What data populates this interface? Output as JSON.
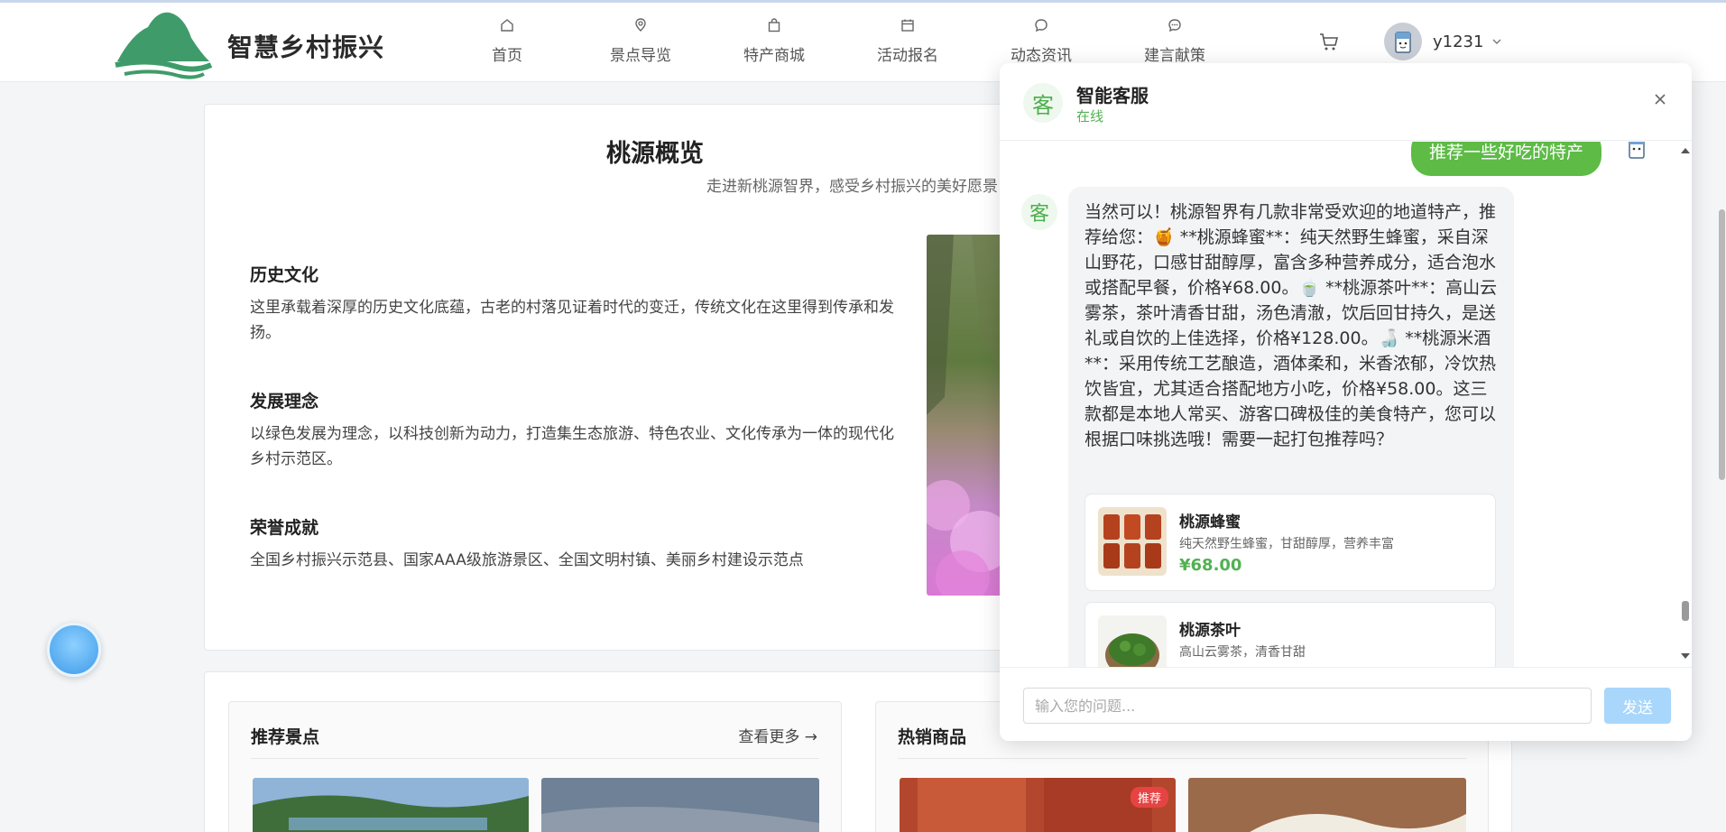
{
  "header": {
    "site_name": "智慧乡村振兴",
    "nav": [
      {
        "label": "首页",
        "icon": "home-icon"
      },
      {
        "label": "景点导览",
        "icon": "map-pin-icon"
      },
      {
        "label": "特产商城",
        "icon": "shopping-bag-icon"
      },
      {
        "label": "活动报名",
        "icon": "calendar-icon"
      },
      {
        "label": "动态资讯",
        "icon": "chat-bubble-icon"
      },
      {
        "label": "建言献策",
        "icon": "comment-dots-icon"
      }
    ],
    "username": "y1231"
  },
  "overview": {
    "title": "桃源概览",
    "subtitle": "走进新桃源智界，感受乡村振兴的美好愿景",
    "sections": [
      {
        "title": "历史文化",
        "text": "这里承载着深厚的历史文化底蕴，古老的村落见证着时代的变迁，传统文化在这里得到传承和发扬。"
      },
      {
        "title": "发展理念",
        "text": "以绿色发展为理念，以科技创新为动力，打造集生态旅游、特色农业、文化传承为一体的现代化乡村示范区。"
      },
      {
        "title": "荣誉成就",
        "text": "全国乡村振兴示范县、国家AAA级旅游景区、全国文明村镇、美丽乡村建设示范点"
      }
    ]
  },
  "recommend": {
    "spots_title": "推荐景点",
    "spots_more": "查看更多 →",
    "goods_title": "热销商品",
    "hot_tag": "推荐"
  },
  "chat": {
    "avatar_char": "客",
    "name": "智能客服",
    "status": "在线",
    "user_message": "推荐一些好吃的特产",
    "bot_reply": "当然可以！桃源智界有几款非常受欢迎的地道特产，推荐给您：🍯 **桃源蜂蜜**：纯天然野生蜂蜜，采自深山野花，口感甘甜醇厚，富含多种营养成分，适合泡水或搭配早餐，价格¥68.00。🍵 **桃源茶叶**：高山云雾茶，茶叶清香甘甜，汤色清澈，饮后回甘持久，是送礼或自饮的上佳选择，价格¥128.00。🍶 **桃源米酒**：采用传统工艺酿造，酒体柔和，米香浓郁，冷饮热饮皆宜，尤其适合搭配地方小吃，价格¥58.00。这三款都是本地人常买、游客口碑极佳的美食特产，您可以根据口味挑选哦！需要一起打包推荐吗？",
    "products": [
      {
        "name": "桃源蜂蜜",
        "desc": "纯天然野生蜂蜜，甘甜醇厚，营养丰富",
        "price": "¥68.00"
      },
      {
        "name": "桃源茶叶",
        "desc": "高山云雾茶，清香甘甜",
        "price": ""
      }
    ],
    "input_placeholder": "输入您的问题...",
    "send_label": "发送"
  },
  "colors": {
    "accent_green": "#52b152",
    "user_bubble": "#5dbb46",
    "send_disabled": "#a9d6fb"
  }
}
